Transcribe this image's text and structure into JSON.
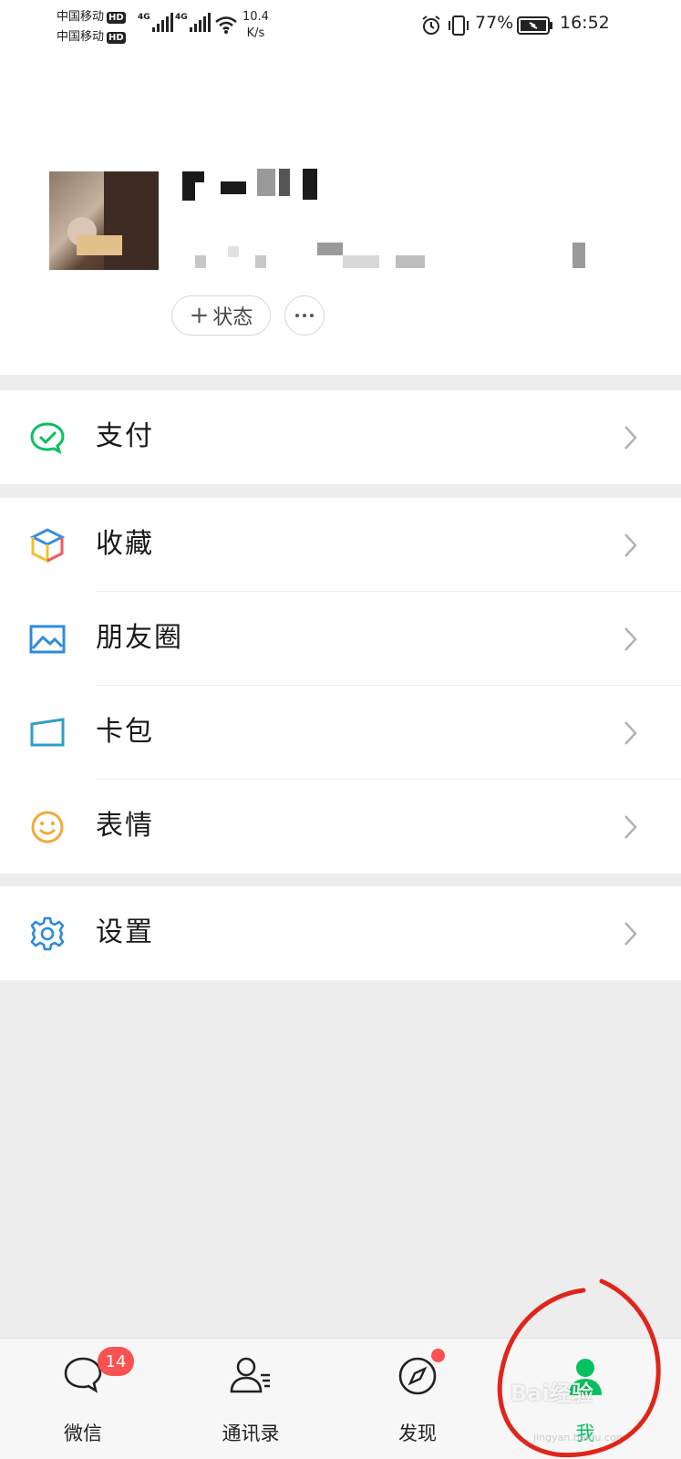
{
  "status_bar": {
    "carrier_1": "中国移动",
    "carrier_2": "中国移动",
    "hd_badge": "HD",
    "network_type": "4G",
    "net_speed_value": "10.4",
    "net_speed_unit": "K/s",
    "battery_percent": "77%",
    "time": "16:52"
  },
  "profile": {
    "status_button_label": "状态"
  },
  "menu": {
    "pay": "支付",
    "favorites": "收藏",
    "moments": "朋友圈",
    "cards": "卡包",
    "stickers": "表情",
    "settings": "设置"
  },
  "tabbar": {
    "chats_label": "微信",
    "chats_badge": "14",
    "contacts_label": "通讯录",
    "discover_label": "发现",
    "me_label": "我"
  },
  "watermark": {
    "brand": "Bai经验",
    "sub": "jingyan.baidu.com"
  },
  "colors": {
    "accent_green": "#07c160",
    "badge_red": "#fa5151",
    "annotation_red": "#e0261a"
  }
}
